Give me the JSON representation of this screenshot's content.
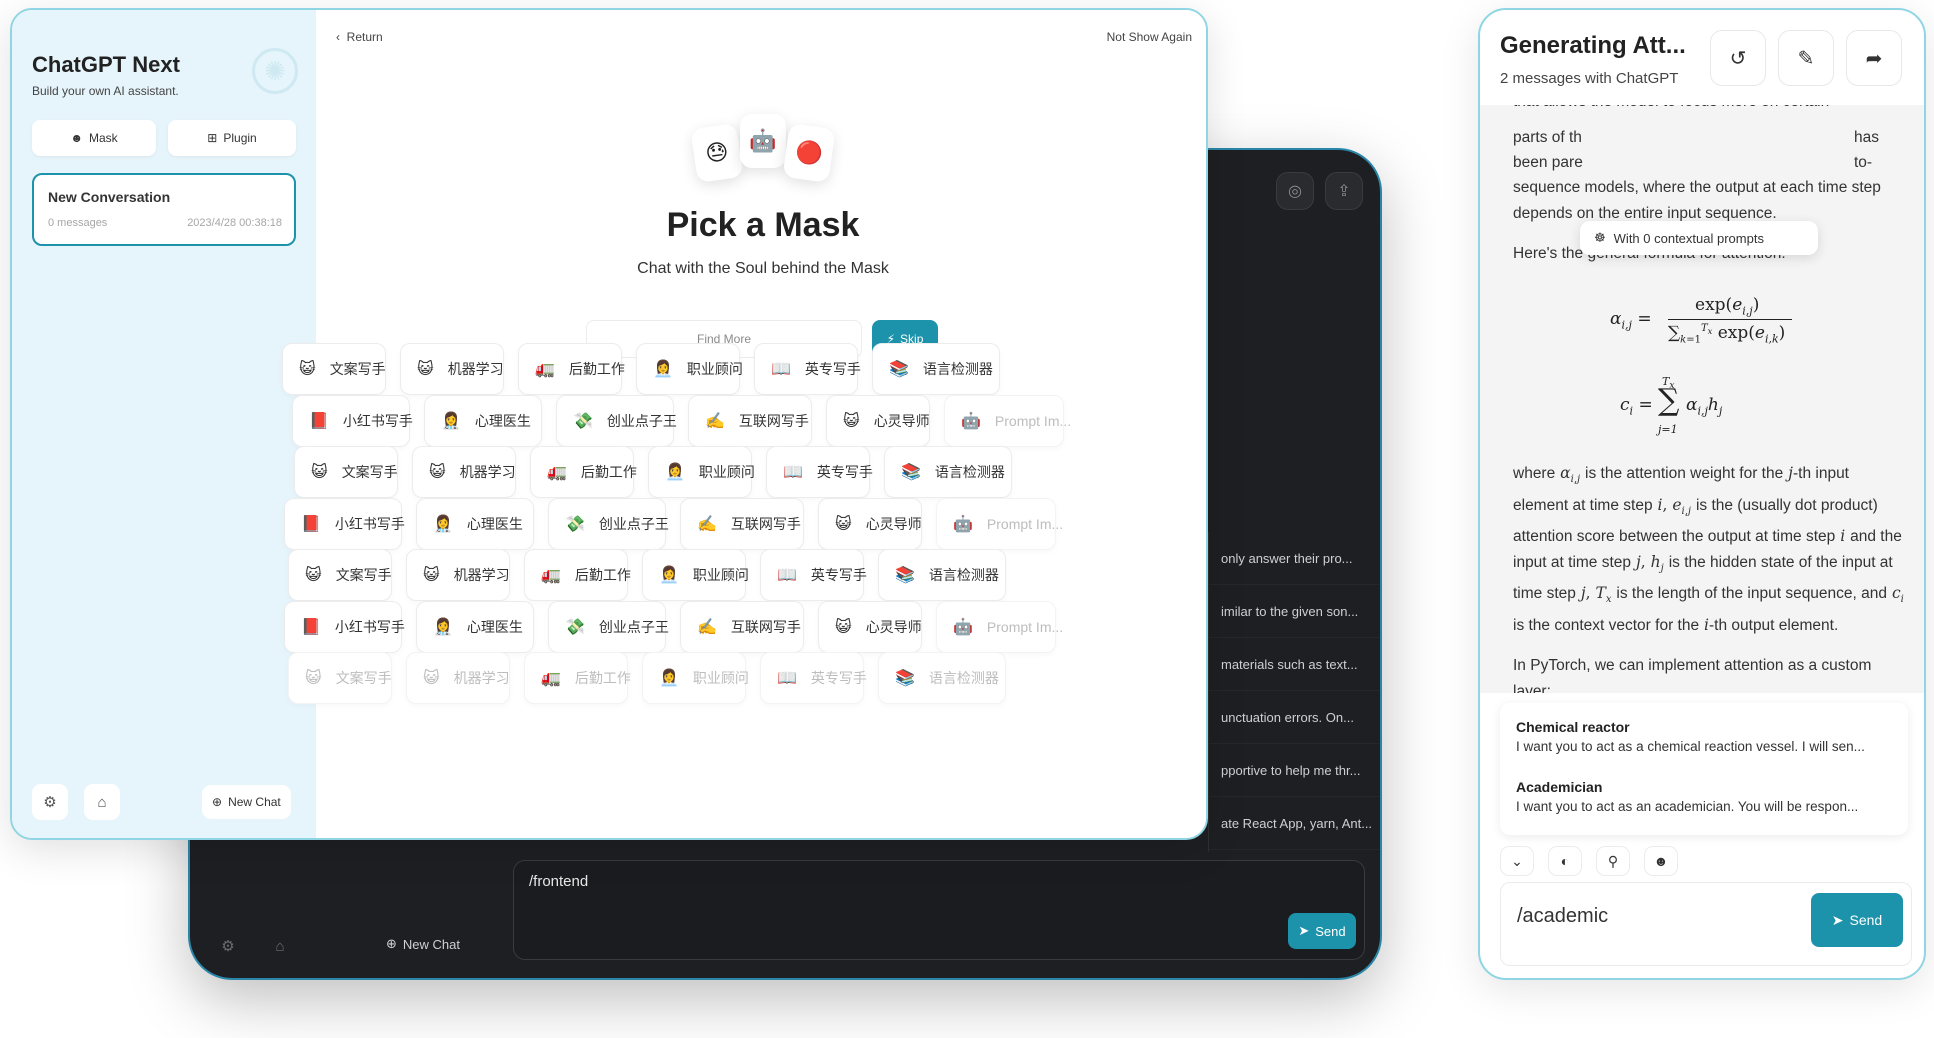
{
  "dark_window": {
    "list_items": [
      "only answer their pro...",
      "imilar to the given son...",
      "materials such as text...",
      "unctuation errors. On...",
      "pportive to help me thr...",
      "ate React App, yarn, Ant..."
    ],
    "input_value": "/frontend",
    "send_label": "Send",
    "new_chat_label": "New Chat"
  },
  "sidebar": {
    "title": "ChatGPT Next",
    "subtitle": "Build your own AI assistant.",
    "mask_label": "Mask",
    "plugin_label": "Plugin",
    "conversation": {
      "title": "New Conversation",
      "count": "0 messages",
      "time": "2023/4/28 00:38:18"
    },
    "new_chat_label": "New Chat"
  },
  "mask_page": {
    "return_label": "Return",
    "not_show_label": "Not Show Again",
    "emojis": [
      "😓",
      "🤖",
      "🔴"
    ],
    "title": "Pick a Mask",
    "subtitle": "Chat with the Soul behind the Mask",
    "find_placeholder": "Find More",
    "skip_label": "Skip",
    "rows": [
      [
        [
          "😺",
          "文案写手"
        ],
        [
          "😺",
          "机器学习"
        ],
        [
          "🚛",
          "后勤工作"
        ],
        [
          "👩‍💼",
          "职业顾问"
        ],
        [
          "📖",
          "英专写手"
        ],
        [
          "📚",
          "语言检测器"
        ]
      ],
      [
        [
          "📕",
          "小红书写手"
        ],
        [
          "👩‍⚕️",
          "心理医生"
        ],
        [
          "💸",
          "创业点子王"
        ],
        [
          "✍️",
          "互联网写手"
        ],
        [
          "😺",
          "心灵导师"
        ],
        [
          "🤖",
          "Prompt Im..."
        ]
      ],
      [
        [
          "😺",
          "文案写手"
        ],
        [
          "😺",
          "机器学习"
        ],
        [
          "🚛",
          "后勤工作"
        ],
        [
          "👩‍💼",
          "职业顾问"
        ],
        [
          "📖",
          "英专写手"
        ],
        [
          "📚",
          "语言检测器"
        ]
      ],
      [
        [
          "📕",
          "小红书写手"
        ],
        [
          "👩‍⚕️",
          "心理医生"
        ],
        [
          "💸",
          "创业点子王"
        ],
        [
          "✍️",
          "互联网写手"
        ],
        [
          "😺",
          "心灵导师"
        ],
        [
          "🤖",
          "Prompt Im..."
        ]
      ],
      [
        [
          "😺",
          "文案写手"
        ],
        [
          "😺",
          "机器学习"
        ],
        [
          "🚛",
          "后勤工作"
        ],
        [
          "👩‍💼",
          "职业顾问"
        ],
        [
          "📖",
          "英专写手"
        ],
        [
          "📚",
          "语言检测器"
        ]
      ],
      [
        [
          "📕",
          "小红书写手"
        ],
        [
          "👩‍⚕️",
          "心理医生"
        ],
        [
          "💸",
          "创业点子王"
        ],
        [
          "✍️",
          "互联网写手"
        ],
        [
          "😺",
          "心灵导师"
        ],
        [
          "🤖",
          "Prompt Im..."
        ]
      ],
      [
        [
          "😺",
          "文案写手"
        ],
        [
          "😺",
          "机器学习"
        ],
        [
          "🚛",
          "后勤工作"
        ],
        [
          "👩‍💼",
          "职业顾问"
        ],
        [
          "📖",
          "英专写手"
        ],
        [
          "📚",
          "语言检测器"
        ]
      ]
    ]
  },
  "chat_window": {
    "title": "Generating Att...",
    "subtitle": "2 messages with ChatGPT",
    "context_pill": "With 0 contextual prompts",
    "text_top": "that allows the model to focus more on certain",
    "text_line1": "parts of th",
    "text_line1_end": "has",
    "text_line2": "been pare",
    "text_line2_end": "to-",
    "text_para1": "sequence models, where the output at each time step depends on the entire input sequence.",
    "text_para2": "Here's the general formula for attention:",
    "text_para3_a": "where",
    "text_para3_b": "is the attention weight for the",
    "text_para3_c": "-th input element at time step",
    "text_para3_d": "is the (usually dot product) attention score between the output at time step",
    "text_para3_e": "and the input at time step",
    "text_para3_f": "is the hidden state of the input at time step",
    "text_para3_g": "is the length of the input sequence, and",
    "text_para3_h": "is the context vector for the",
    "text_para3_i": "-th output element.",
    "text_para4": "In PyTorch, we can implement attention as a custom layer:",
    "prompts": [
      {
        "title": "Chemical reactor",
        "desc": "I want you to act as a chemical reaction vessel. I will sen..."
      },
      {
        "title": "Academician",
        "desc": "I want you to act as an academician. You will be respon..."
      }
    ],
    "input_value": "/academic",
    "send_label": "Send"
  }
}
